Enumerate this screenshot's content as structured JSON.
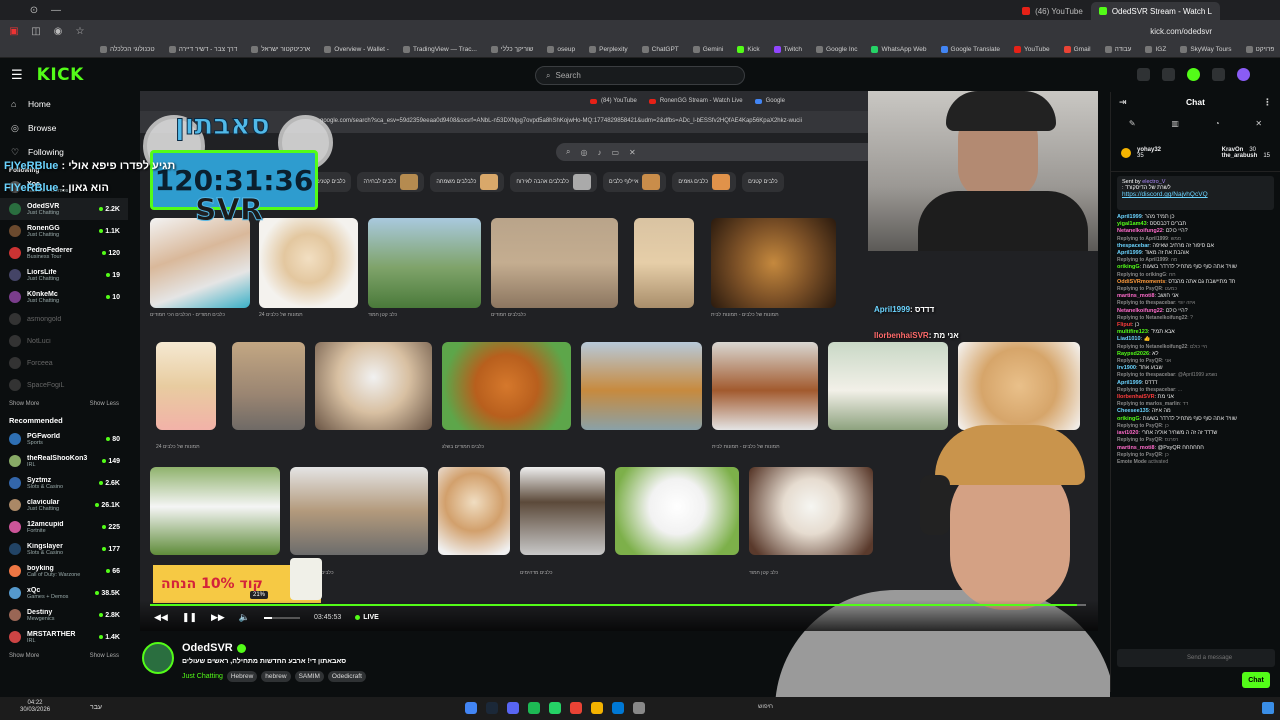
{
  "browser": {
    "tabs": [
      {
        "label": "(46) YouTube",
        "active": false
      },
      {
        "label": "OdedSVR Stream - Watch L",
        "active": true
      }
    ],
    "url": "kick.com/odedsvr",
    "bookmarks": [
      "טכנולוגי הכלכלה",
      "דרך צבר - דשיר דיירה",
      "ארכיטקטור ישראל",
      "Overview - Wallet -",
      "TradingView — Trac...",
      "שוריקך כללי",
      "oseup",
      "Perplexity",
      "ChatGPT",
      "Gemini",
      "Kick",
      "Twitch",
      "Google Inc",
      "WhatsApp Web",
      "Google Translate",
      "YouTube",
      "Gmail",
      "עבודה",
      "IGZ",
      "SkyWay Tours",
      "פרויקט"
    ]
  },
  "kick": {
    "logo": "KICK",
    "search_placeholder": "Search"
  },
  "sidebar": {
    "nav": [
      {
        "label": "Home",
        "icon": "home-icon"
      },
      {
        "label": "Browse",
        "icon": "compass-icon"
      },
      {
        "label": "Following",
        "icon": "heart-icon"
      }
    ],
    "following_label": "Following",
    "following": [
      {
        "name": "Xoc",
        "category": "Games + Demos",
        "viewers": ""
      },
      {
        "name": "OdedSVR",
        "category": "Just Chatting",
        "viewers": "2.2K"
      },
      {
        "name": "RonenGG",
        "category": "Just Chatting",
        "viewers": "1.1K"
      },
      {
        "name": "PedroFederer",
        "category": "Business Tour",
        "viewers": "120"
      },
      {
        "name": "LiorsLife",
        "category": "Just Chatting",
        "viewers": "19"
      },
      {
        "name": "K0nkeMc",
        "category": "Just Chatting",
        "viewers": "10"
      }
    ],
    "offline": [
      "asmongold",
      "NotLuci",
      "Forceea",
      "SpaceFogiL"
    ],
    "show_more": "Show More",
    "show_less": "Show Less",
    "recommended_label": "Recommended",
    "recommended": [
      {
        "name": "PGFworld",
        "category": "Sports",
        "viewers": "80"
      },
      {
        "name": "theRealShooKon3",
        "category": "IRL",
        "viewers": "149"
      },
      {
        "name": "Syztmz",
        "category": "Slots & Casino",
        "viewers": "2.6K"
      },
      {
        "name": "clavicular",
        "category": "Just Chatting",
        "viewers": "26.1K"
      },
      {
        "name": "12amcupid",
        "category": "Fortnite",
        "viewers": "225"
      },
      {
        "name": "Kingslayer",
        "category": "Slots & Casino",
        "viewers": "177"
      },
      {
        "name": "boyking",
        "category": "Call of Duty: Warzone",
        "viewers": "66"
      },
      {
        "name": "xQc",
        "category": "Games + Demos",
        "viewers": "38.5K"
      },
      {
        "name": "Destiny",
        "category": "Mewgenics",
        "viewers": "2.8K"
      },
      {
        "name": "MRSTARTHER",
        "category": "IRL",
        "viewers": "1.4K"
      }
    ]
  },
  "video": {
    "inner_tabs": [
      "(84) YouTube",
      "RonenGG Stream - Watch Live",
      "Google"
    ],
    "inner_url": "google.com/search?sca_esv=59d2359eeaa0d9408&sxsrf=ANbL-n53DXNpg7ovpd5a8hShKojwHo-MQ:1774829858421&udm=2&dfbs=ADc_l-bESSfv2HQfAE4Kap56KpaX2hkz-wucii",
    "chips": [
      "כלבים קטנים",
      "כלבים לבחירה",
      "כלבלבים משמחה",
      "כלבלבים אהבה לאירוח",
      "איילוף כלבים",
      "כלבים גוזמים",
      "כלבים קטנים"
    ],
    "timer": "120:31:36",
    "overlay_head": "סאבתון",
    "overlay_svr": "SVR",
    "overlay_chat": [
      {
        "user": "FIYeRBlue",
        "text": ": תגיע לפדרו פיפא אולי"
      },
      {
        "user": "FIYeRBlue",
        "text": ": הוא גאון"
      }
    ],
    "promo_text": "קוד 10% הנחה",
    "webcam_chat": [
      {
        "user": "Liad1010",
        "text": ""
      },
      {
        "user": "April1999",
        "text": ": דדדס"
      },
      {
        "user": "IlorbenhaiSVR",
        "text": ": אני מת"
      }
    ],
    "image_captions": [
      "כלבים חמודים - הכלבים הכי חמודים",
      "24 תמונות של כלבים",
      "כלב קטן חמוד",
      "כלבלבים חמודים",
      "תמונות של כלבים - תמונות לבית",
      "כלבים חמודים בשלג",
      "כלבים קטנים חמודים",
      "כלבים מדהימים"
    ],
    "volume_pct": "21%",
    "elapsed": "03:45:53",
    "live_label": "LIVE",
    "progress": 0.99,
    "volume_level": 0.21
  },
  "channel": {
    "name": "OdedSVR",
    "title": "סאבאתון די! ארבע החדשות מתחילה, ראשים שעולים",
    "category": "Just Chatting",
    "tags": [
      "Hebrew",
      "hebrew",
      "SAMIM",
      "Odedicraft"
    ]
  },
  "chat": {
    "title": "Chat",
    "leaderboard": [
      {
        "user": "yohay32",
        "amount": "35"
      },
      {
        "user": "KravOn",
        "amount": "30"
      },
      {
        "user": "the_arabush",
        "amount": "15"
      }
    ],
    "pinned_sender": "electro_V",
    "pinned_label": ": לשרת של הדיסקורד",
    "pinned_link": "https://discord.gg/NajvhQcVQ",
    "messages": [
      {
        "user": "April1999",
        "text": ": כן תמיד מהר",
        "color": "#6bd4ff",
        "reply": false
      },
      {
        "user": "yigal1am43",
        "text": ": תברים דכבססס",
        "color": "#53fc18",
        "reply": false
      },
      {
        "user": "Netanelkoifung22",
        "text": ": היי כולם?",
        "color": "#ff6bcb",
        "reply": false
      },
      {
        "user": "Replying to April1999",
        "text": ": ממש",
        "color": "#888",
        "reply": true
      },
      {
        "user": "thespacebar",
        "text": ": אם סיפור זה מרחיב שאיפה",
        "color": "#6bd4ff",
        "reply": false
      },
      {
        "user": "April1999",
        "text": ": אוהבת את זה מאוד",
        "color": "#6bd4ff",
        "reply": false
      },
      {
        "user": "Replying to April1999",
        "text": ": מה",
        "color": "#888",
        "reply": true
      },
      {
        "user": "orikingG",
        "text": ": שוויד אתה סוף סוף מתחיל לדרדר בשעות",
        "color": "#53fc18",
        "reply": false
      },
      {
        "user": "Replying to orikingG",
        "text": ": חח",
        "color": "#888",
        "reply": true
      },
      {
        "user": "OddiSVRmoments",
        "text": ": חד מתיישבת גם אתה מהנדס",
        "color": "#ff9b3c",
        "reply": false
      },
      {
        "user": "Replying to PsyQR",
        "text": ": כמעט",
        "color": "#888",
        "reply": true
      },
      {
        "user": "martins_moti8",
        "text": ": אני חושב",
        "color": "#ff6bcb",
        "reply": false
      },
      {
        "user": "Replying to thespacebar",
        "text": ": איזה יופי",
        "color": "#888",
        "reply": true
      },
      {
        "user": "Netanelkoifung22",
        "text": ": היי כולם?",
        "color": "#ff6bcb",
        "reply": false
      },
      {
        "user": "Replying to Netanelkoifung22",
        "text": ": ?",
        "color": "#888",
        "reply": true
      },
      {
        "user": "Fliput",
        "text": ": כן",
        "color": "#ff3c3c",
        "reply": false
      },
      {
        "user": "multifire123",
        "text": ": אבא תמיד",
        "color": "#53fc18",
        "reply": false
      },
      {
        "user": "Liad1010",
        "text": ": 👍",
        "color": "#6bd4ff",
        "reply": false
      },
      {
        "user": "Replying to Netanelkoifung22",
        "text": ": היי כולם",
        "color": "#888",
        "reply": true
      },
      {
        "user": "Raypsd2026",
        "text": ": לא",
        "color": "#53fc18",
        "reply": false
      },
      {
        "user": "Replying to PsyQR",
        "text": ": אני",
        "color": "#888",
        "reply": true
      },
      {
        "user": "Irv1900",
        "text": ": שבוע אחד",
        "color": "#6bd4ff",
        "reply": false
      },
      {
        "user": "Replying to thespacebar",
        "text": ": @April1999 נשמע",
        "color": "#888",
        "reply": true
      },
      {
        "user": "April1999",
        "text": ": דדדס",
        "color": "#6bd4ff",
        "reply": false
      },
      {
        "user": "Replying to thespacebar",
        "text": ": ...",
        "color": "#888",
        "reply": true
      },
      {
        "user": "IlorbenhaiSVR",
        "text": ": אני מת",
        "color": "#ff3c3c",
        "reply": false
      },
      {
        "user": "Replying to marlos_marlin",
        "text": ": דד",
        "color": "#888",
        "reply": true
      },
      {
        "user": "Cheesee135",
        "text": ": מה איזה",
        "color": "#6bd4ff",
        "reply": false
      },
      {
        "user": "orikingG",
        "text": ": שוויד אתה סוף סוף מתחיל לדרדר בשעות",
        "color": "#53fc18",
        "reply": false
      },
      {
        "user": "Replying to PsyQR",
        "text": ": כן",
        "color": "#888",
        "reply": true
      },
      {
        "user": "iavi1020",
        "text": ": שדדד זה זה ה משחיר אוליה אחרי",
        "color": "#ff6bcb",
        "reply": false
      },
      {
        "user": "Replying to PsyQR",
        "text": ": רפרנס",
        "color": "#888",
        "reply": true
      },
      {
        "user": "martins_moti8",
        "text": ": @PsyQR חחחחחח",
        "color": "#ff6bcb",
        "reply": false
      },
      {
        "user": "Replying to PsyQR",
        "text": ": כן",
        "color": "#888",
        "reply": true
      },
      {
        "user": "Emote Mode",
        "text": " activated",
        "color": "#888",
        "reply": true
      }
    ],
    "input_placeholder": "Send a message",
    "send_label": "Chat"
  },
  "taskbar": {
    "time": "04:22",
    "date": "30/03/2026",
    "lang": "עבר",
    "search": "חיפוש"
  }
}
